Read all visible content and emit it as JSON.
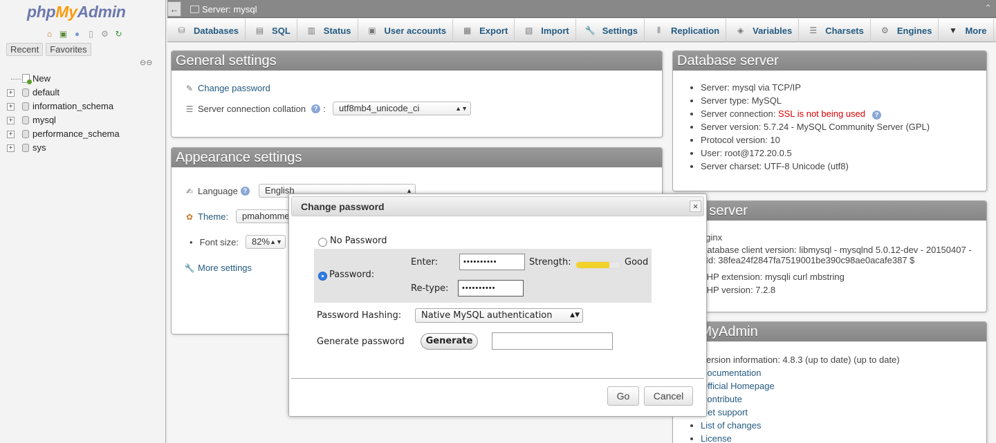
{
  "nav": {
    "logo": {
      "part1": "php",
      "part2": "My",
      "part3": "Admin"
    },
    "quick_icons": [
      "home-icon",
      "logout-icon",
      "help-icon",
      "docs-icon",
      "settings-icon",
      "reload-icon"
    ],
    "recent_label": "Recent",
    "favorites_label": "Favorites",
    "tree": [
      {
        "label": "New",
        "type": "new"
      },
      {
        "label": "default",
        "type": "db"
      },
      {
        "label": "information_schema",
        "type": "db"
      },
      {
        "label": "mysql",
        "type": "db"
      },
      {
        "label": "performance_schema",
        "type": "db"
      },
      {
        "label": "sys",
        "type": "db"
      }
    ]
  },
  "topbar": {
    "back": "←",
    "breadcrumb": "Server: mysql",
    "collapse": "⌃"
  },
  "menu": {
    "tabs": [
      {
        "label": "Databases",
        "icon": "database-icon"
      },
      {
        "label": "SQL",
        "icon": "sql-icon"
      },
      {
        "label": "Status",
        "icon": "status-icon"
      },
      {
        "label": "User accounts",
        "icon": "users-icon"
      },
      {
        "label": "Export",
        "icon": "export-icon"
      },
      {
        "label": "Import",
        "icon": "import-icon"
      },
      {
        "label": "Settings",
        "icon": "wrench-icon"
      },
      {
        "label": "Replication",
        "icon": "replication-icon"
      },
      {
        "label": "Variables",
        "icon": "variables-icon"
      },
      {
        "label": "Charsets",
        "icon": "charsets-icon"
      },
      {
        "label": "Engines",
        "icon": "engines-icon"
      },
      {
        "label": "More",
        "icon": "caret-down-icon"
      }
    ]
  },
  "general": {
    "title": "General settings",
    "change_password": "Change password",
    "collation_label": "Server connection collation",
    "collation_value": "utf8mb4_unicode_ci"
  },
  "appearance": {
    "title": "Appearance settings",
    "language_label": "Language",
    "language_value": "English",
    "theme_label": "Theme:",
    "theme_value": "pmahomme",
    "fontsize_label": "Font size:",
    "fontsize_value": "82%",
    "more_settings": "More settings"
  },
  "db_server": {
    "title": "Database server",
    "items": [
      {
        "text": "Server: mysql via TCP/IP"
      },
      {
        "text": "Server type: MySQL"
      },
      {
        "text": "Server connection: ",
        "red": "SSL is not being used"
      },
      {
        "text": "Server version: 5.7.24 - MySQL Community Server (GPL)"
      },
      {
        "text": "Protocol version: 10"
      },
      {
        "text": "User: root@172.20.0.5"
      },
      {
        "text": "Server charset: UTF-8 Unicode (utf8)"
      }
    ]
  },
  "web_server": {
    "title": "Web server",
    "items": [
      "nginx",
      "Database client version: libmysql - mysqlnd 5.0.12-dev - 20150407 - $Id: 38fea24f2847fa7519001be390c98ae0acafe387 $",
      "PHP extension: mysqli  curl  mbstring",
      "PHP version: 7.2.8"
    ]
  },
  "pma_box": {
    "title": "phpMyAdmin",
    "version": "Version information: 4.8.3 (up to date) (up to date)",
    "links": [
      "Documentation",
      "Official Homepage",
      "Contribute",
      "Get support",
      "List of changes",
      "License"
    ]
  },
  "dialog": {
    "title": "Change password",
    "close": "×",
    "no_password": "No Password",
    "password_label": "Password:",
    "enter_label": "Enter:",
    "retype_label": "Re-type:",
    "enter_value": "••••••••••",
    "retype_value": "••••••••••",
    "strength_label": "Strength:",
    "strength_text": "Good",
    "strength_level": 0.75,
    "hashing_label": "Password Hashing:",
    "hashing_value": "Native MySQL authentication",
    "generate_label": "Generate password",
    "generate_button": "Generate",
    "generate_value": "",
    "go_button": "Go",
    "cancel_button": "Cancel"
  },
  "colors": {
    "link": "#235a81",
    "header_gray": "#8f8f8f",
    "logo_blue": "#6c78af",
    "logo_orange": "#f89c0e",
    "radio_blue": "#2f7fe6",
    "meter_yellow": "#f2d22a",
    "error_red": "#dd0000"
  }
}
